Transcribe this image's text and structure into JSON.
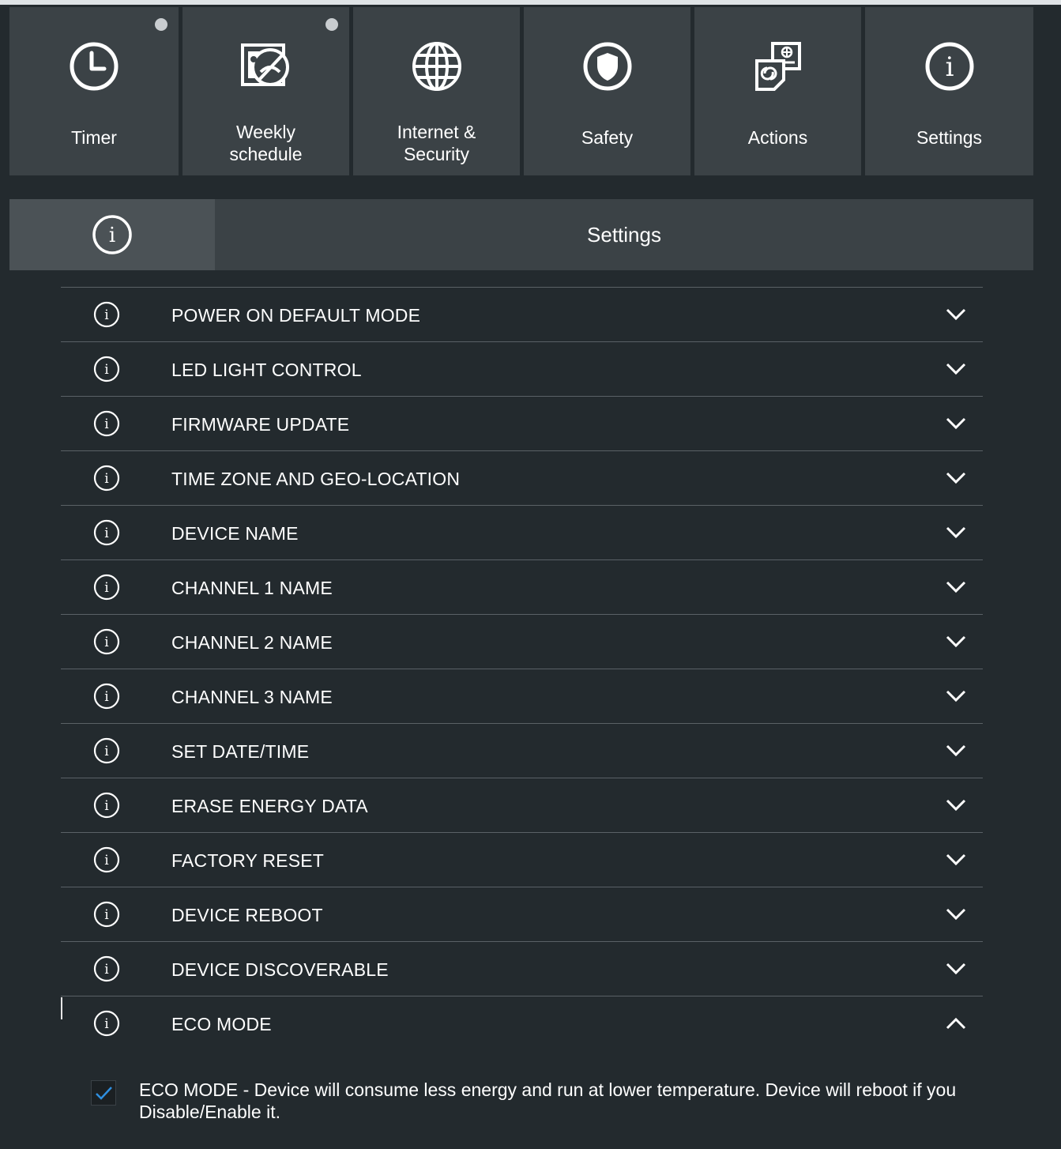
{
  "tabs": [
    {
      "label": "Timer",
      "icon": "clock-icon",
      "dot": true
    },
    {
      "label": "Weekly\nschedule",
      "icon": "weekly-schedule-icon",
      "dot": true
    },
    {
      "label": "Internet &\nSecurity",
      "icon": "globe-icon",
      "dot": false
    },
    {
      "label": "Safety",
      "icon": "shield-icon",
      "dot": false
    },
    {
      "label": "Actions",
      "icon": "actions-icon",
      "dot": false
    },
    {
      "label": "Settings",
      "icon": "info-icon",
      "dot": false
    }
  ],
  "section": {
    "title": "Settings",
    "icon": "info-icon"
  },
  "settings_items": [
    {
      "label": "POWER ON DEFAULT MODE",
      "expanded": false
    },
    {
      "label": "LED LIGHT CONTROL",
      "expanded": false
    },
    {
      "label": "FIRMWARE UPDATE",
      "expanded": false
    },
    {
      "label": "TIME ZONE AND GEO-LOCATION",
      "expanded": false
    },
    {
      "label": "DEVICE NAME",
      "expanded": false
    },
    {
      "label": "CHANNEL 1 NAME",
      "expanded": false
    },
    {
      "label": "CHANNEL 2 NAME",
      "expanded": false
    },
    {
      "label": "CHANNEL 3 NAME",
      "expanded": false
    },
    {
      "label": "SET DATE/TIME",
      "expanded": false
    },
    {
      "label": "ERASE ENERGY DATA",
      "expanded": false
    },
    {
      "label": "FACTORY RESET",
      "expanded": false
    },
    {
      "label": "DEVICE REBOOT",
      "expanded": false
    },
    {
      "label": "DEVICE DISCOVERABLE",
      "expanded": false
    },
    {
      "label": "ECO MODE",
      "expanded": true
    }
  ],
  "eco_mode": {
    "checked": true,
    "description": "ECO MODE - Device will consume less energy and run at lower temperature. Device will reboot if you Disable/Enable it."
  },
  "colors": {
    "background": "#232a2e",
    "tile": "#3b4246",
    "check": "#2f8fe0"
  }
}
